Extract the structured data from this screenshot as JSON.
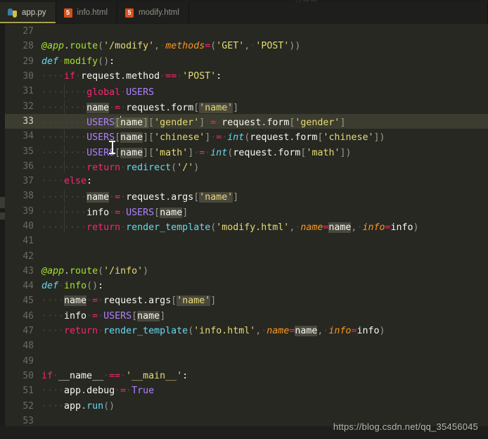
{
  "window": {
    "theme_background": "#272822",
    "accent": "#a6a44e"
  },
  "tabbar": {
    "tabs": [
      {
        "label": "app.py",
        "icon": "python-icon",
        "active": true
      },
      {
        "label": "info.html",
        "icon": "html5-icon",
        "active": false
      },
      {
        "label": "modify.html",
        "icon": "html5-icon",
        "active": false
      }
    ]
  },
  "editor": {
    "language": "Python",
    "current_line": 33,
    "first_visible_line": 27,
    "last_visible_line": 53,
    "lines": [
      {
        "n": "27",
        "text": ""
      },
      {
        "n": "28",
        "text": "@app.route('/modify', methods=('GET', 'POST'))"
      },
      {
        "n": "29",
        "text": "def modify():"
      },
      {
        "n": "30",
        "text": "    if request.method == 'POST':"
      },
      {
        "n": "31",
        "text": "        global USERS"
      },
      {
        "n": "32",
        "text": "        name = request.form['name']"
      },
      {
        "n": "33",
        "text": "        USERS[name]['gender'] = request.form['gender']"
      },
      {
        "n": "34",
        "text": "        USERS[name]['chinese'] = int(request.form['chinese'])"
      },
      {
        "n": "35",
        "text": "        USERS[name]['math'] = int(request.form['math'])"
      },
      {
        "n": "36",
        "text": "        return redirect('/')"
      },
      {
        "n": "37",
        "text": "    else:"
      },
      {
        "n": "38",
        "text": "        name = request.args['name']"
      },
      {
        "n": "39",
        "text": "        info = USERS[name]"
      },
      {
        "n": "40",
        "text": "        return render_template('modify.html', name=name, info=info)"
      },
      {
        "n": "41",
        "text": ""
      },
      {
        "n": "42",
        "text": ""
      },
      {
        "n": "43",
        "text": "@app.route('/info')"
      },
      {
        "n": "44",
        "text": "def info():"
      },
      {
        "n": "45",
        "text": "    name = request.args['name']"
      },
      {
        "n": "46",
        "text": "    info = USERS[name]"
      },
      {
        "n": "47",
        "text": "    return render_template('info.html', name=name, info=info)"
      },
      {
        "n": "48",
        "text": ""
      },
      {
        "n": "49",
        "text": ""
      },
      {
        "n": "50",
        "text": "if __name__ == '__main__':"
      },
      {
        "n": "51",
        "text": "    app.debug = True"
      },
      {
        "n": "52",
        "text": "    app.run()"
      },
      {
        "n": "53",
        "text": ""
      }
    ]
  },
  "watermark": {
    "text": "https://blog.csdn.net/qq_35456045"
  }
}
